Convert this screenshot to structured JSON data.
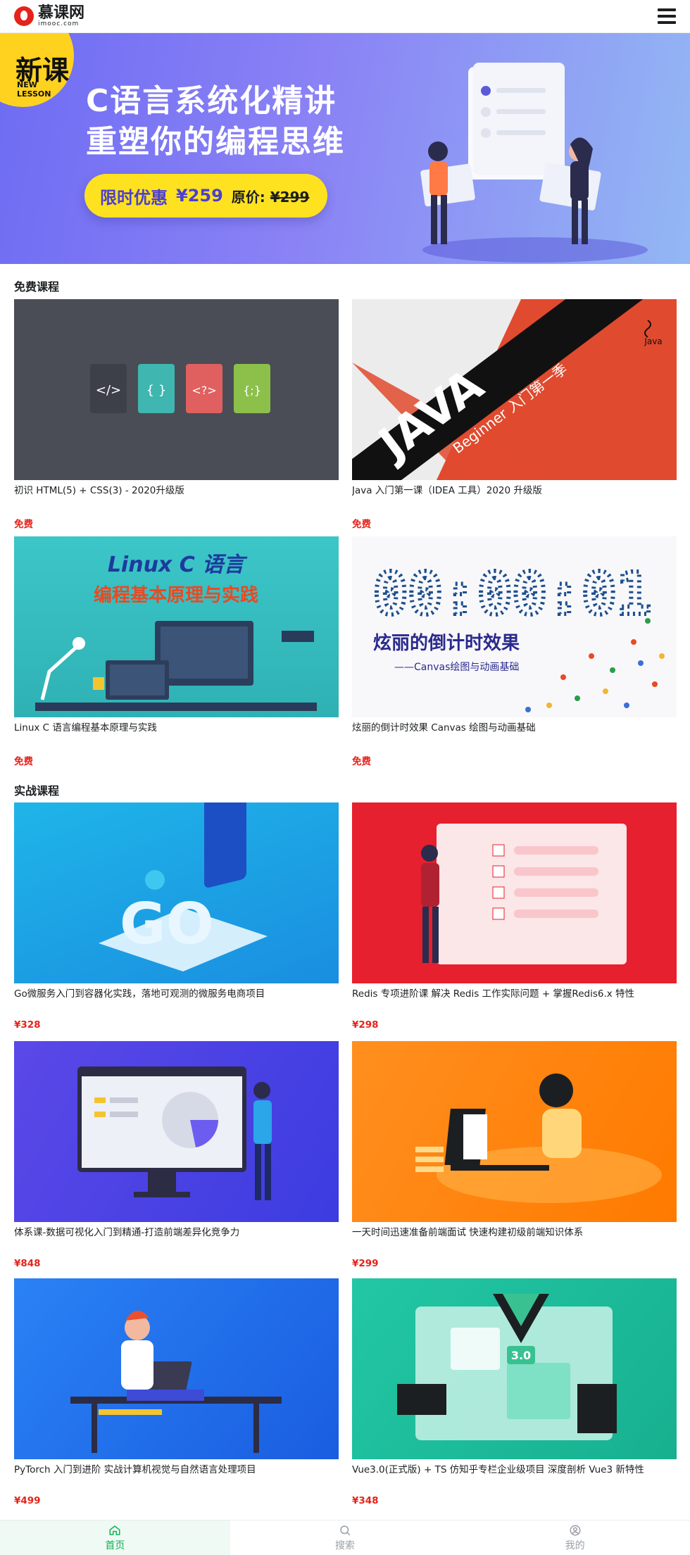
{
  "header": {
    "logo_text": "慕课网",
    "logo_sub": "imooc.com",
    "menu_icon": "hamburger-menu-icon"
  },
  "banner": {
    "badge_title": "新课",
    "badge_sub": "NEW LESSON",
    "title_line1": "C语言系统化精讲",
    "title_line2": "重塑你的编程思维",
    "promo_label": "限时优惠",
    "promo_price": "¥259",
    "promo_orig_label": "原价:",
    "promo_orig_price": "¥299"
  },
  "free_section": {
    "title": "免费课程",
    "courses": [
      {
        "title": "初识 HTML(5) + CSS(3) - 2020升级版",
        "price": "免费"
      },
      {
        "title": "Java 入门第一课（IDEA 工具）2020 升级版",
        "price": "免费"
      },
      {
        "title": "Linux C 语言编程基本原理与实践",
        "price": "免费"
      },
      {
        "title": "炫丽的倒计时效果 Canvas 绘图与动画基础",
        "price": "免费"
      }
    ]
  },
  "paid_section": {
    "title": "实战课程",
    "courses": [
      {
        "title": "Go微服务入门到容器化实践，落地可观测的微服务电商项目",
        "price": "¥328"
      },
      {
        "title": "Redis 专项进阶课 解决 Redis 工作实际问题 + 掌握Redis6.x 特性",
        "price": "¥298"
      },
      {
        "title": "体系课-数据可视化入门到精通-打造前端差异化竞争力",
        "price": "¥848"
      },
      {
        "title": "一天时间迅速准备前端面试 快速构建初级前端知识体系",
        "price": "¥299"
      },
      {
        "title": "PyTorch 入门到进阶 实战计算机视觉与自然语言处理项目",
        "price": "¥499"
      },
      {
        "title": "Vue3.0(正式版) + TS 仿知乎专栏企业级项目 深度剖析 Vue3 新特性",
        "price": "¥348"
      }
    ]
  },
  "thumb_text": {
    "java_big": "JAVA",
    "java_sub": "Beginner 入门第一季",
    "java_logo": "Java",
    "linux_title": "Linux C 语言",
    "linux_sub": "编程基本原理与实践",
    "clock": "00:00:01",
    "canvas_title": "炫丽的倒计时效果",
    "canvas_sub": "——Canvas绘图与动画基础",
    "go_text": "GO",
    "vue_version": "3.0"
  },
  "tabbar": {
    "tabs": [
      {
        "label": "首页",
        "icon": "home-icon"
      },
      {
        "label": "搜索",
        "icon": "search-icon"
      },
      {
        "label": "我的",
        "icon": "user-icon"
      }
    ]
  },
  "colors": {
    "brand_red": "#e5231a",
    "active_green": "#13b05a",
    "promo_yellow": "#ffe21f"
  }
}
